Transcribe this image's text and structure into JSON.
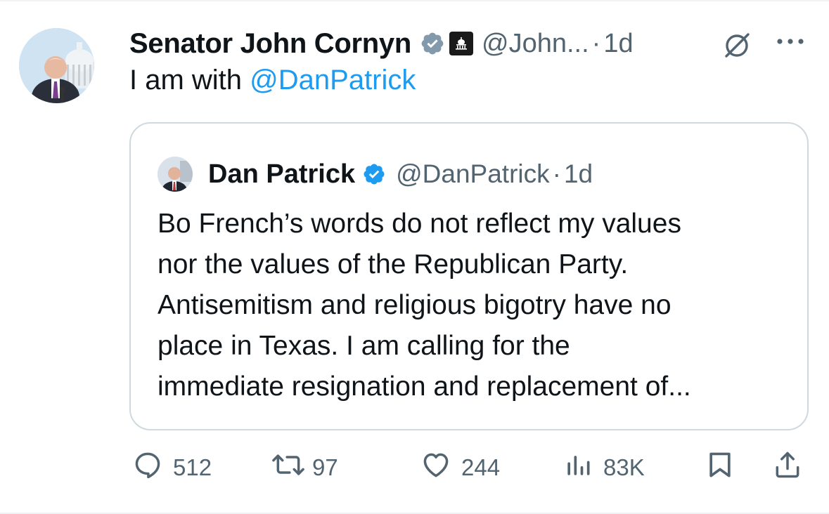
{
  "tweet": {
    "author_name": "Senator John Cornyn",
    "handle": "@John...",
    "separator": "·",
    "time": "1d",
    "text_prefix": "I am with ",
    "mention": "@DanPatrick",
    "icons": {
      "verified": "verified-badge-icon",
      "affiliate": "capitol-building-badge-icon",
      "grok": "grok-icon",
      "more": "more-options-icon"
    }
  },
  "quote": {
    "author_name": "Dan Patrick",
    "handle": "@DanPatrick",
    "separator": "·",
    "time": "1d",
    "lines": [
      "Bo French’s words do not reflect my values",
      "nor the values of the Republican Party.",
      "Antisemitism and religious bigotry have no",
      "place in Texas. I am calling for the",
      "immediate resignation and replacement of..."
    ]
  },
  "actions": {
    "replies": "512",
    "reposts": "97",
    "likes": "244",
    "views": "83K",
    "icons": [
      "reply-icon",
      "repost-icon",
      "like-icon",
      "views-icon",
      "bookmark-icon",
      "share-icon"
    ]
  },
  "colors": {
    "text": "#0f1419",
    "secondary": "#536471",
    "link": "#1d9bf0",
    "border": "#cfd9de"
  }
}
